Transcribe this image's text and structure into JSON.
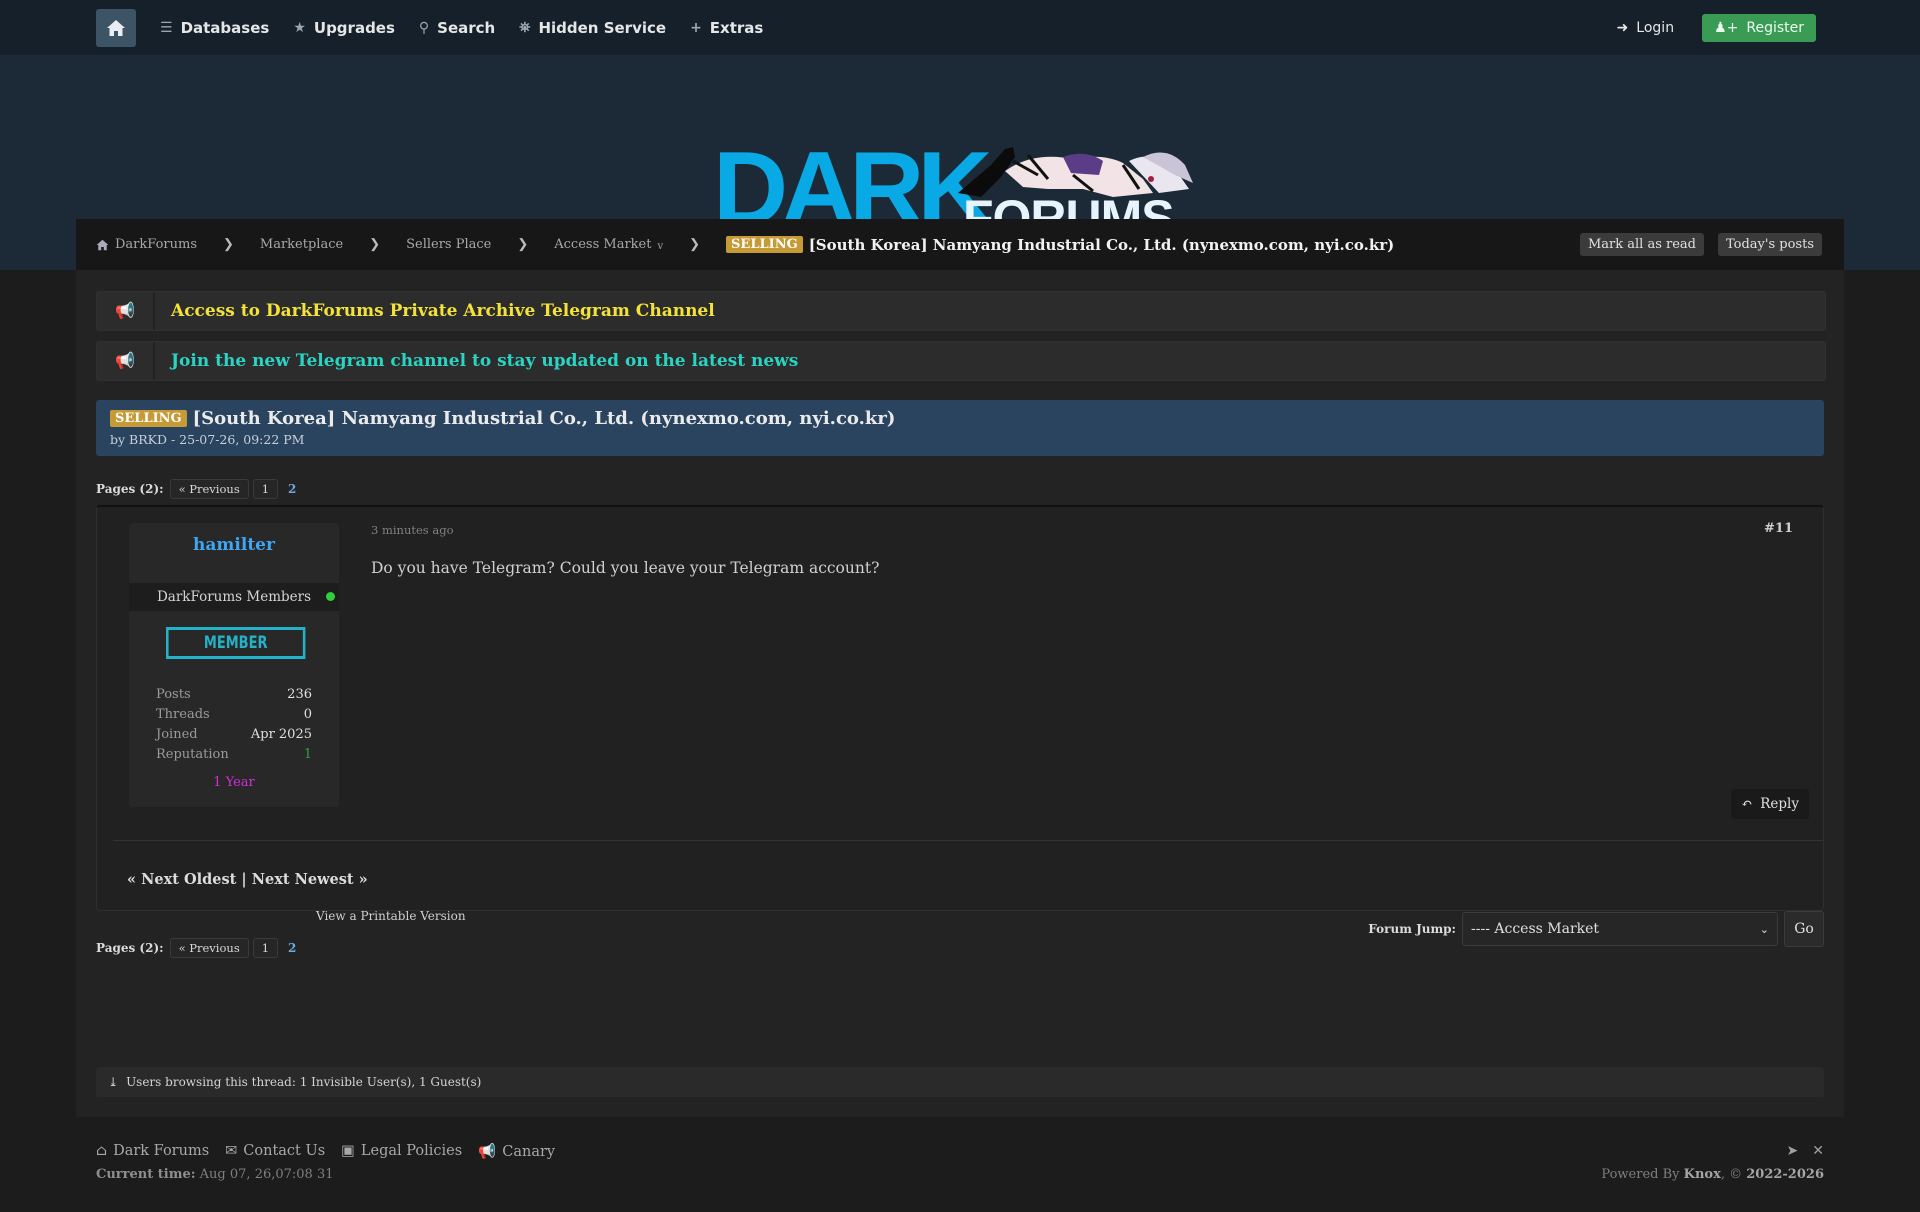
{
  "nav": {
    "items": [
      "Databases",
      "Upgrades",
      "Search",
      "Hidden Service",
      "Extras"
    ],
    "login": "Login",
    "register": "Register"
  },
  "logo": {
    "part1": "DARK",
    "part2": "FORUMS"
  },
  "breadcrumb": {
    "items": [
      "DarkForums",
      "Marketplace",
      "Sellers Place",
      "Access Market"
    ],
    "dropdown_marker": "v",
    "prefix": "SELLING",
    "title": "[South Korea] Namyang Industrial Co., Ltd. (nynexmo.com, nyi.co.kr)",
    "buttons": [
      "Mark all as read",
      "Today's posts"
    ]
  },
  "announcements": [
    {
      "text": "Access to DarkForums Private Archive Telegram Channel",
      "color": "#f2e23a"
    },
    {
      "text": "Join the new Telegram channel to stay updated on the latest news",
      "color": "#2ad4c2"
    }
  ],
  "thread": {
    "prefix": "SELLING",
    "title": "[South Korea] Namyang Industrial Co., Ltd. (nynexmo.com, nyi.co.kr)",
    "meta": "by BRKD - 25-07-26, 09:22 PM"
  },
  "pagination": {
    "label": "Pages (2):",
    "prev": "« Previous",
    "page1": "1",
    "page2": "2"
  },
  "post": {
    "author": {
      "name": "hamilter",
      "group": "DarkForums Members",
      "rank": "MEMBER",
      "stats": [
        {
          "label": "Posts",
          "value": "236"
        },
        {
          "label": "Threads",
          "value": "0"
        },
        {
          "label": "Joined",
          "value": "Apr 2025"
        },
        {
          "label": "Reputation",
          "value": "1"
        }
      ],
      "tenure": "1 Year"
    },
    "date": "3 minutes ago",
    "number": "#11",
    "body": "Do you have Telegram? Could you leave your Telegram account?",
    "reply": "Reply"
  },
  "thread_nav": "« Next Oldest | Next Newest »",
  "printable": "View a Printable Version",
  "forum_jump": {
    "label": "Forum Jump:",
    "selected": "---- Access Market",
    "go": "Go"
  },
  "browsing": "Users browsing this thread: 1 Invisible User(s), 1 Guest(s)",
  "footer": {
    "links": [
      "Dark Forums",
      "Contact Us",
      "Legal Policies",
      "Canary"
    ],
    "time_label": "Current time:",
    "time_value": "Aug 07, 26,07:08 31",
    "powered_prefix": "Powered By",
    "powered_name": "Knox",
    "powered_suffix": ", ©",
    "powered_years": "2022-2026"
  }
}
